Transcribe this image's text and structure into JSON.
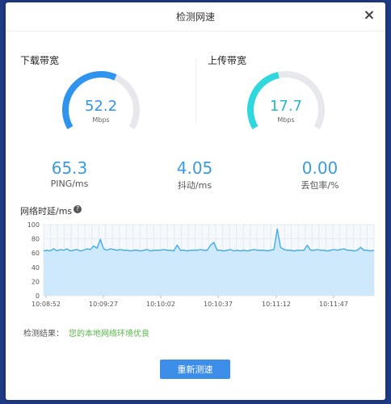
{
  "dialog": {
    "title": "检测网速"
  },
  "download": {
    "label": "下载带宽",
    "value": "52.2",
    "unit": "Mbps",
    "fraction": 0.6,
    "color": "#2e94ee"
  },
  "upload": {
    "label": "上传带宽",
    "value": "17.7",
    "unit": "Mbps",
    "fraction": 0.45,
    "color": "#2fd8de"
  },
  "stats": [
    {
      "value": "65.3",
      "label": "PING/ms"
    },
    {
      "value": "4.05",
      "label": "抖动/ms"
    },
    {
      "value": "0.00",
      "label": "丢包率/%"
    }
  ],
  "latency": {
    "title": "网络时延/ms",
    "help": "?"
  },
  "chart_data": {
    "type": "area",
    "ylim": [
      0,
      100
    ],
    "yticks": [
      0,
      20,
      40,
      60,
      80,
      100
    ],
    "xticks": [
      "10:08:52",
      "10:09:27",
      "10:10:02",
      "10:10:37",
      "10:11:12",
      "10:11:47"
    ],
    "grid": true,
    "color": "#3aa8e8",
    "fill": "#cde9fb",
    "values": [
      63,
      64,
      63,
      66,
      63,
      65,
      64,
      66,
      63,
      64,
      65,
      63,
      64,
      66,
      65,
      70,
      67,
      79,
      66,
      64,
      66,
      65,
      64,
      65,
      64,
      64,
      63,
      64,
      64,
      63,
      64,
      65,
      63,
      64,
      64,
      64,
      65,
      64,
      64,
      63,
      71,
      64,
      64,
      63,
      64,
      64,
      64,
      65,
      64,
      64,
      71,
      75,
      64,
      64,
      63,
      64,
      65,
      63,
      64,
      63,
      64,
      63,
      64,
      65,
      64,
      64,
      64,
      63,
      64,
      65,
      94,
      68,
      65,
      64,
      64,
      63,
      64,
      64,
      64,
      71,
      64,
      64,
      65,
      64,
      64,
      63,
      64,
      65,
      64,
      65,
      66,
      64,
      64,
      63,
      64,
      68,
      64,
      64,
      63,
      64
    ]
  },
  "result": {
    "label": "检测结果：",
    "text": "您的本地网络环境优良"
  },
  "retest_button": "重新测速"
}
